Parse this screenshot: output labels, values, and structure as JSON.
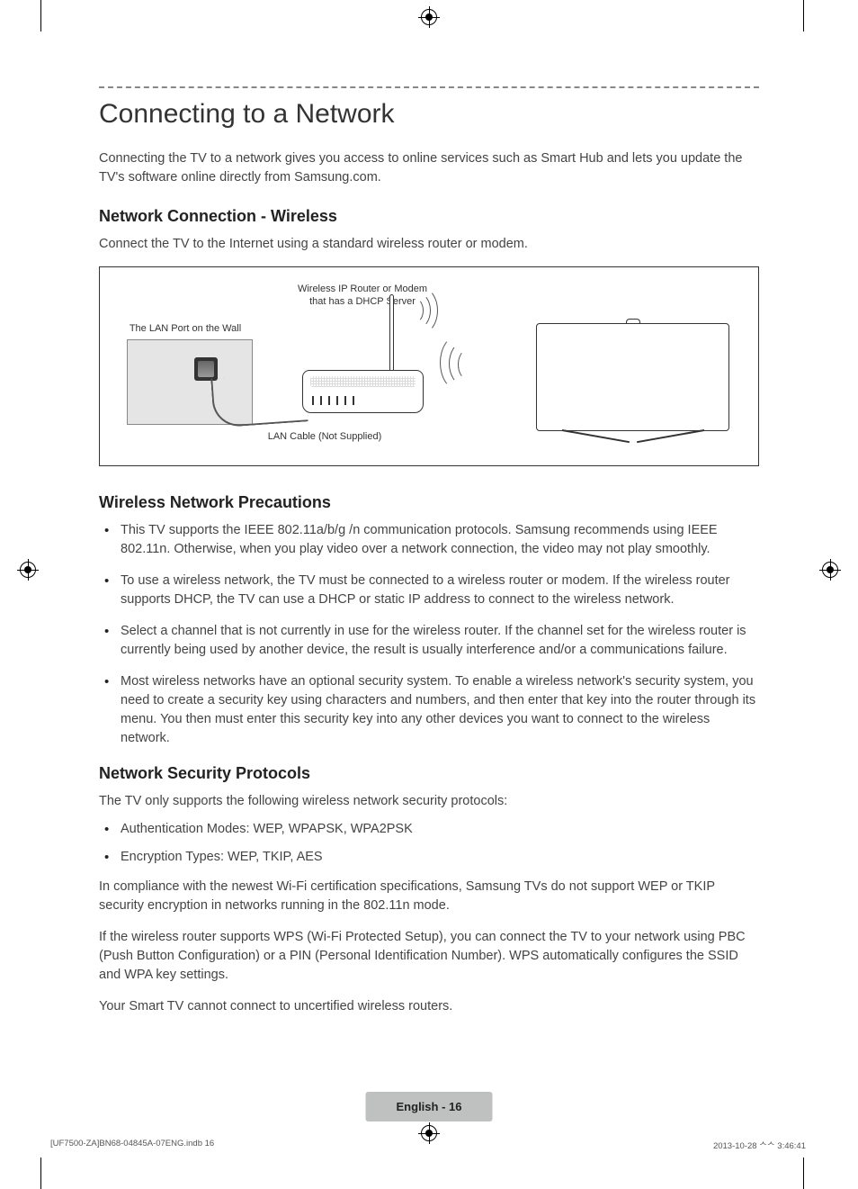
{
  "title": "Connecting to a Network",
  "intro": "Connecting the TV to a network gives you access to online services such as Smart Hub and lets you update the TV's software online directly from Samsung.com.",
  "section1": {
    "heading": "Network Connection - Wireless",
    "text": "Connect the TV to the Internet using a standard wireless router or modem."
  },
  "diagram": {
    "router_label": "Wireless IP Router or Modem\nthat has a DHCP Server",
    "wall_label": "The LAN Port on the Wall",
    "cable_label": "LAN Cable (Not Supplied)"
  },
  "section2": {
    "heading": "Wireless Network Precautions",
    "items": [
      "This TV supports the IEEE 802.11a/b/g /n communication protocols. Samsung recommends using IEEE 802.11n. Otherwise, when you play video over a network connection, the video may not play smoothly.",
      "To use a wireless network, the TV must be connected to a wireless router or modem. If the wireless router supports DHCP, the TV can use a DHCP or static IP address to connect to the wireless network.",
      "Select a channel that is not currently in use for the wireless router. If the channel set for the wireless router is currently being used by another device, the result is usually interference and/or a communications failure.",
      "Most wireless networks have an optional security system. To enable a wireless network's security system, you need to create a security key using characters and numbers, and then enter that key into the router through its menu. You then must enter this security key into any other devices you want to connect to the wireless network."
    ]
  },
  "section3": {
    "heading": "Network Security Protocols",
    "intro": "The TV only supports the following wireless network security protocols:",
    "items": [
      "Authentication Modes: WEP, WPAPSK, WPA2PSK",
      "Encryption Types: WEP, TKIP, AES"
    ],
    "p1": "In compliance with the newest Wi-Fi certification specifications, Samsung TVs do not support WEP or TKIP security encryption in networks running in the 802.11n mode.",
    "p2": "If the wireless router supports WPS (Wi-Fi Protected Setup), you can connect the TV to your network using PBC (Push Button Configuration) or a PIN (Personal Identification Number). WPS automatically configures the SSID and WPA key settings.",
    "p3": "Your Smart TV cannot connect to uncertified wireless routers."
  },
  "page_badge": "English - 16",
  "footer_left": "[UF7500-ZA]BN68-04845A-07ENG.indb   16",
  "footer_right": "2013-10-28   ᄉᄉ 3:46:41"
}
